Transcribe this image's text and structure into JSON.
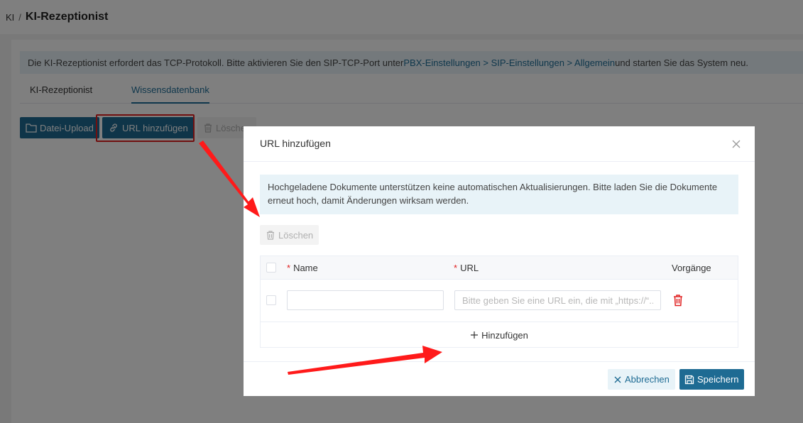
{
  "breadcrumb": {
    "root": "KI",
    "separator": "/",
    "title": "KI-Rezeptionist"
  },
  "notice": {
    "prefix": "Die KI-Rezeptionist erfordert das TCP-Protokoll. Bitte aktivieren Sie den SIP-TCP-Port unter ",
    "link": "PBX-Einstellungen > SIP-Einstellungen > Allgemein",
    "suffix": " und starten Sie das System neu."
  },
  "tabs": [
    {
      "label": "KI-Rezeptionist",
      "active": false
    },
    {
      "label": "Wissensdatenbank",
      "active": true
    }
  ],
  "toolbar": {
    "upload_label": "Datei-Upload",
    "add_url_label": "URL hinzufügen",
    "delete_label": "Löschen"
  },
  "dialog": {
    "title": "URL hinzufügen",
    "info": "Hochgeladene Dokumente unterstützen keine automatischen Aktualisierungen. Bitte laden Sie die Dokumente erneut hoch, damit Änderungen wirksam werden.",
    "delete_label": "Löschen",
    "table": {
      "columns": {
        "name": "Name",
        "url": "URL",
        "actions": "Vorgänge"
      },
      "required_mark": "*",
      "row": {
        "name_value": "",
        "url_value": "",
        "url_placeholder": "Bitte geben Sie eine URL ein, die mit „https://“..."
      }
    },
    "add_row_label": "Hinzufügen",
    "cancel_label": "Abbrechen",
    "save_label": "Speichern"
  },
  "colors": {
    "primary": "#1e6b93",
    "info_bg": "#e8f3f8",
    "danger": "#e02020",
    "annotation": "#ff1a1a"
  }
}
